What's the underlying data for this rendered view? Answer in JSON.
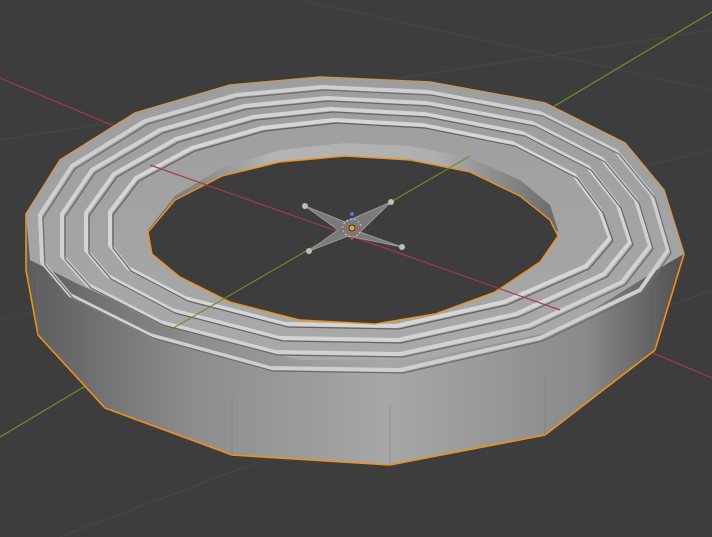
{
  "viewport": {
    "background": "#3d3d3d",
    "grid_color": "#474747",
    "x_axis_color": "#a43b48",
    "y_axis_color": "#6e8c2b",
    "selection_outline": "#f0901c",
    "mesh_color": "#9a9a9a",
    "object_origin_color": "#f2a21c"
  },
  "scene": {
    "selected_object": "ring-mesh",
    "gizmo": "empty-object-star-icon"
  }
}
